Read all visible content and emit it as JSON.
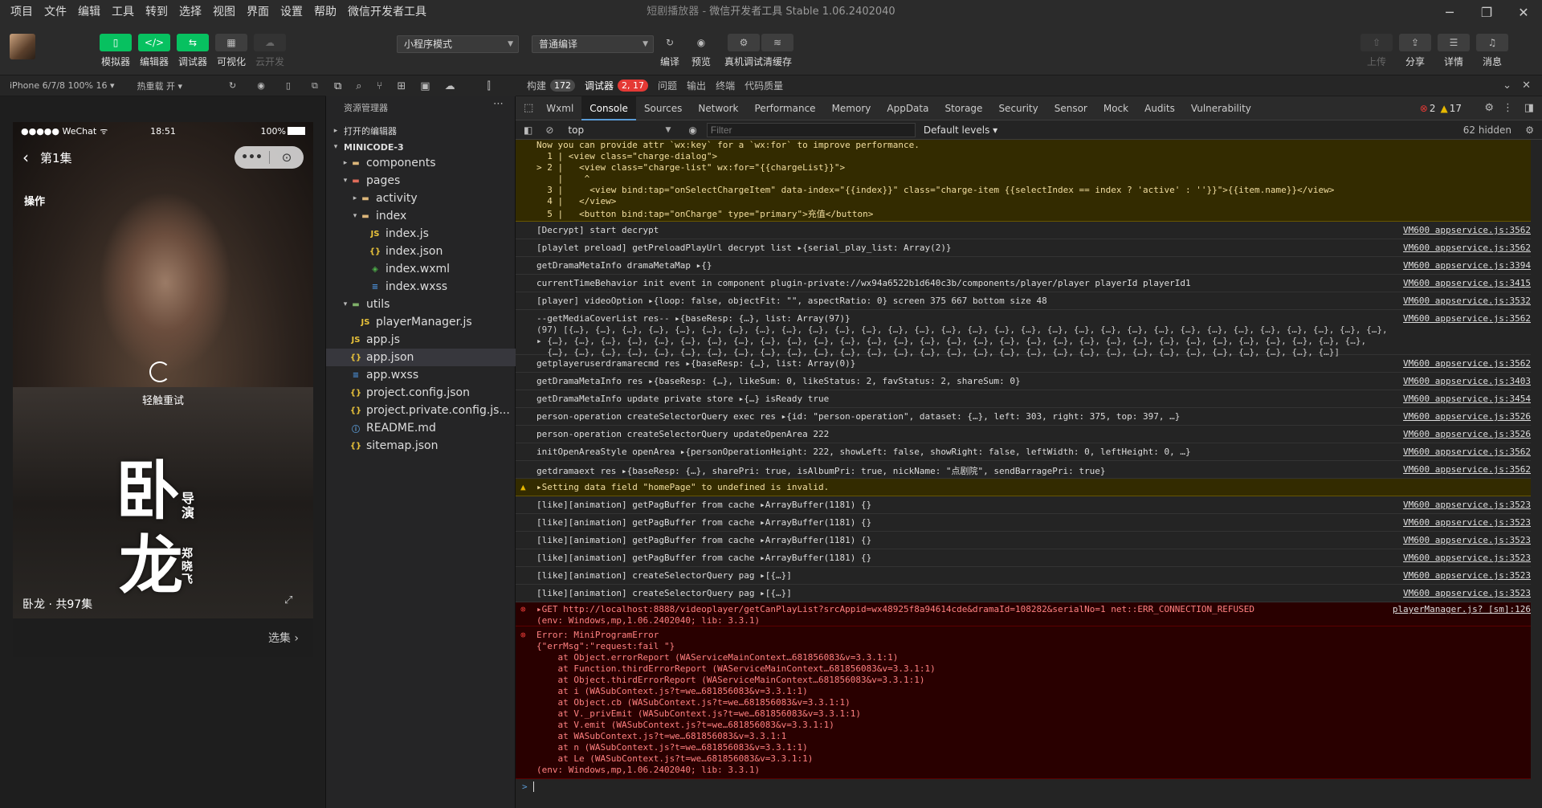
{
  "menu": [
    "项目",
    "文件",
    "编辑",
    "工具",
    "转到",
    "选择",
    "视图",
    "界面",
    "设置",
    "帮助",
    "微信开发者工具"
  ],
  "window": {
    "title": "短剧播放器",
    "app": "微信开发者工具 Stable 1.06.2402040"
  },
  "toolbar": {
    "buttons": [
      {
        "label": "模拟器",
        "glyph": "▯"
      },
      {
        "label": "编辑器",
        "glyph": "</>"
      },
      {
        "label": "调试器",
        "glyph": "⇆"
      },
      {
        "label": "可视化",
        "glyph": "▦"
      },
      {
        "label": "云开发",
        "glyph": "☁"
      }
    ],
    "mode_select": "小程序模式",
    "compile_select": "普通编译",
    "actions": [
      "编译",
      "预览",
      "真机调试",
      "清缓存"
    ],
    "right_actions": [
      "上传",
      "分享",
      "详情",
      "消息"
    ]
  },
  "devicebar": {
    "device": "iPhone 6/7/8 100% 16",
    "hot_reload": "热重载 开"
  },
  "phone": {
    "carrier": "●●●●● WeChat",
    "time": "18:51",
    "battery": "100%",
    "nav_title": "第1集",
    "operation": "操作",
    "retry": "轻触重试",
    "calligraphy_1": "卧",
    "calligraphy_2": "龙",
    "side_text_1": "导演",
    "side_text_2": "郑晓飞",
    "series_info": "卧龙 · 共97集",
    "select_episode": "选集"
  },
  "explorer": {
    "title": "资源管理器",
    "open_editors": "打开的编辑器",
    "project": "MINICODE-3",
    "items": [
      {
        "label": "components",
        "depth": 1,
        "arrow": "▸",
        "type": "folder"
      },
      {
        "label": "pages",
        "depth": 1,
        "arrow": "▾",
        "type": "folder-red"
      },
      {
        "label": "activity",
        "depth": 2,
        "arrow": "▸",
        "type": "folder"
      },
      {
        "label": "index",
        "depth": 2,
        "arrow": "▾",
        "type": "folder"
      },
      {
        "label": "index.js",
        "depth": 3,
        "arrow": "",
        "type": "js"
      },
      {
        "label": "index.json",
        "depth": 3,
        "arrow": "",
        "type": "json"
      },
      {
        "label": "index.wxml",
        "depth": 3,
        "arrow": "",
        "type": "wxml"
      },
      {
        "label": "index.wxss",
        "depth": 3,
        "arrow": "",
        "type": "wxss"
      },
      {
        "label": "utils",
        "depth": 1,
        "arrow": "▾",
        "type": "folder-green"
      },
      {
        "label": "playerManager.js",
        "depth": 2,
        "arrow": "",
        "type": "js"
      },
      {
        "label": "app.js",
        "depth": 1,
        "arrow": "",
        "type": "js"
      },
      {
        "label": "app.json",
        "depth": 1,
        "arrow": "",
        "type": "json",
        "selected": true
      },
      {
        "label": "app.wxss",
        "depth": 1,
        "arrow": "",
        "type": "wxss"
      },
      {
        "label": "project.config.json",
        "depth": 1,
        "arrow": "",
        "type": "json"
      },
      {
        "label": "project.private.config.js...",
        "depth": 1,
        "arrow": "",
        "type": "json"
      },
      {
        "label": "README.md",
        "depth": 1,
        "arrow": "",
        "type": "info"
      },
      {
        "label": "sitemap.json",
        "depth": 1,
        "arrow": "",
        "type": "json"
      }
    ]
  },
  "devtools": {
    "top_tabs": [
      {
        "label": "构建",
        "badge": "172"
      },
      {
        "label": "调试器",
        "badge": "2, 17",
        "active": true
      },
      {
        "label": "问题"
      },
      {
        "label": "输出"
      },
      {
        "label": "终端"
      },
      {
        "label": "代码质量"
      }
    ],
    "tabs": [
      "Wxml",
      "Console",
      "Sources",
      "Network",
      "Performance",
      "Memory",
      "AppData",
      "Storage",
      "Security",
      "Sensor",
      "Mock",
      "Audits",
      "Vulnerability"
    ],
    "active_tab": "Console",
    "error_count": "2",
    "warn_count": "17",
    "context": "top",
    "filter_placeholder": "Filter",
    "levels": "Default levels",
    "hidden": "62 hidden"
  },
  "console": {
    "warn_top": [
      "Now you can provide attr `wx:key` for a `wx:for` to improve performance.",
      "  1 | <view class=\"charge-dialog\">",
      "> 2 |   <view class=\"charge-list\" wx:for=\"{{chargeList}}\">",
      "    |    ^",
      "  3 |     <view bind:tap=\"onSelectChargeItem\" data-index=\"{{index}}\" class=\"charge-item {{selectIndex == index ? 'active' : ''}}\">{{item.name}}</view>",
      "  4 |   </view>",
      "  5 |   <button bind:tap=\"onCharge\" type=\"primary\">充值</button>"
    ],
    "logs": [
      {
        "text": "[Decrypt] start decrypt",
        "src": "VM600 appservice.js:3562"
      },
      {
        "text": "[playlet preload] getPreloadPlayUrl decrypt list ▸{serial_play_list: Array(2)}",
        "src": "VM600 appservice.js:3562"
      },
      {
        "text": "getDramaMetaInfo dramaMetaMap ▸{}",
        "src": "VM600 appservice.js:3394"
      },
      {
        "text": "currentTimeBehavior init event in component plugin-private://wx94a6522b1d640c3b/components/player/player playerId playerId1",
        "src": "VM600 appservice.js:3415"
      },
      {
        "text": "[player] videoOption ▸{loop: false, objectFit: \"\", aspectRatio: 0} screen 375 667 bottom size 48",
        "src": "VM600 appservice.js:3532"
      },
      {
        "text": "--getMediaCoverList res-- ▸{baseResp: {…}, list: Array(97)}",
        "src": "VM600 appservice.js:3562",
        "extra": [
          "(97) [{…}, {…}, {…}, {…}, {…}, {…}, {…}, {…}, {…}, {…}, {…}, {…}, {…}, {…}, {…}, {…}, {…}, {…}, {…}, {…}, {…}, {…}, {…}, {…}, {…}, {…}, {…}, {…}, {…}, {…}, {…},",
          "▸ {…}, {…}, {…}, {…}, {…}, {…}, {…}, {…}, {…}, {…}, {…}, {…}, {…}, {…}, {…}, {…}, {…}, {…}, {…}, {…}, {…}, {…}, {…}, {…}, {…}, {…}, {…}, {…}, {…}, {…}, {…},",
          "  {…}, {…}, {…}, {…}, {…}, {…}, {…}, {…}, {…}, {…}, {…}, {…}, {…}, {…}, {…}, {…}, {…}, {…}, {…}, {…}, {…}, {…}, {…}, {…}, {…}, {…}, {…}, {…}, {…}, {…}]"
        ]
      },
      {
        "text": "getplayeruserdramarecmd res ▸{baseResp: {…}, list: Array(0)}",
        "src": "VM600 appservice.js:3562"
      },
      {
        "text": "getDramaMetaInfo res ▸{baseResp: {…}, likeSum: 0, likeStatus: 2, favStatus: 2, shareSum: 0}",
        "src": "VM600 appservice.js:3403"
      },
      {
        "text": "getDramaMetaInfo update private store ▸{…} isReady true",
        "src": "VM600 appservice.js:3454"
      },
      {
        "text": "person-operation createSelectorQuery exec res ▸{id: \"person-operation\", dataset: {…}, left: 303, right: 375, top: 397, …}",
        "src": "VM600 appservice.js:3526"
      },
      {
        "text": "person-operation createSelectorQuery updateOpenArea 222",
        "src": "VM600 appservice.js:3526"
      },
      {
        "text": "initOpenAreaStyle openArea ▸{personOperationHeight: 222, showLeft: false, showRight: false, leftWidth: 0, leftHeight: 0, …}",
        "src": "VM600 appservice.js:3562"
      },
      {
        "text": "getdramaext res ▸{baseResp: {…}, sharePri: true, isAlbumPri: true, nickName: \"点剧院\", sendBarragePri: true}",
        "src": "VM600 appservice.js:3562"
      }
    ],
    "warn_mid": "▸Setting data field \"homePage\" to undefined is invalid.",
    "logs2": [
      {
        "text": "[like][animation] getPagBuffer from cache ▸ArrayBuffer(1181) {}",
        "src": "VM600 appservice.js:3523"
      },
      {
        "text": "[like][animation] getPagBuffer from cache ▸ArrayBuffer(1181) {}",
        "src": "VM600 appservice.js:3523"
      },
      {
        "text": "[like][animation] getPagBuffer from cache ▸ArrayBuffer(1181) {}",
        "src": "VM600 appservice.js:3523"
      },
      {
        "text": "[like][animation] getPagBuffer from cache ▸ArrayBuffer(1181) {}",
        "src": "VM600 appservice.js:3523"
      },
      {
        "text": "[like][animation] createSelectorQuery pag ▸[{…}]",
        "src": "VM600 appservice.js:3523"
      },
      {
        "text": "[like][animation] createSelectorQuery pag ▸[{…}]",
        "src": "VM600 appservice.js:3523"
      }
    ],
    "err1": {
      "lines": [
        "▸GET http://localhost:8888/videoplayer/getCanPlayList?srcAppid=wx48925f8a94614cde&dramaId=108282&serialNo=1 net::ERR_CONNECTION_REFUSED",
        "(env: Windows,mp,1.06.2402040; lib: 3.3.1)"
      ],
      "src": "playerManager.js? [sm]:126"
    },
    "err2": [
      "Error: MiniProgramError",
      "{\"errMsg\":\"request:fail \"}",
      "    at Object.errorReport (WAServiceMainContext…681856083&v=3.3.1:1)",
      "    at Function.thirdErrorReport (WAServiceMainContext…681856083&v=3.3.1:1)",
      "    at Object.thirdErrorReport (WAServiceMainContext…681856083&v=3.3.1:1)",
      "    at i (WASubContext.js?t=we…681856083&v=3.3.1:1)",
      "    at Object.cb (WASubContext.js?t=we…681856083&v=3.3.1:1)",
      "    at V._privEmit (WASubContext.js?t=we…681856083&v=3.3.1:1)",
      "    at V.emit (WASubContext.js?t=we…681856083&v=3.3.1:1)",
      "    at WASubContext.js?t=we…681856083&v=3.3.1:1",
      "    at n (WASubContext.js?t=we…681856083&v=3.3.1:1)",
      "    at Le (WASubContext.js?t=we…681856083&v=3.3.1:1)",
      "(env: Windows,mp,1.06.2402040; lib: 3.3.1)"
    ],
    "prompt": ">"
  },
  "colors": {
    "accent_green": "#07c160",
    "error_red": "#e53935",
    "warn_yellow": "#e6b800",
    "link_blue": "#5b9bd5"
  }
}
